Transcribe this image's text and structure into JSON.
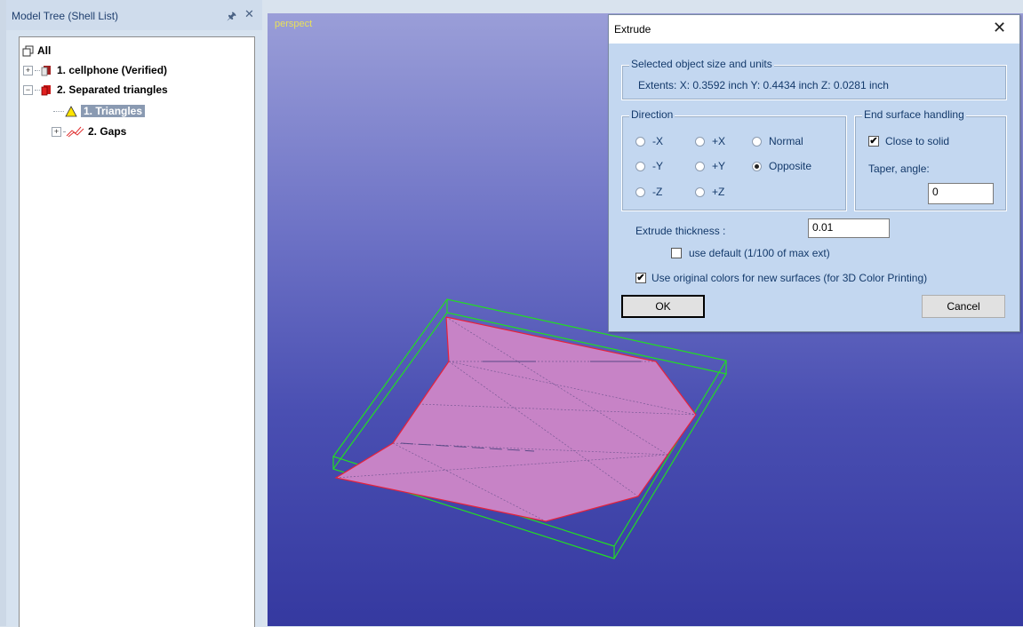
{
  "tree_panel": {
    "title": "Model Tree (Shell List)",
    "items": [
      {
        "label": "All",
        "icon": "shells-icon"
      },
      {
        "label": "1. cellphone (Verified)",
        "icon": "shell-icon"
      },
      {
        "label": "2. Separated triangles",
        "icon": "red-shell-icon"
      },
      {
        "label": "1. Triangles",
        "icon": "warning-triangle-icon",
        "selected": true
      },
      {
        "label": "2. Gaps",
        "icon": "gaps-icon"
      }
    ]
  },
  "viewport": {
    "view_label": "perspect"
  },
  "dialog": {
    "title": "Extrude",
    "size_group": {
      "caption": "Selected object size and units",
      "extents": "Extents:  X: 0.3592 inch  Y: 0.4434 inch  Z: 0.0281 inch"
    },
    "direction_group": {
      "caption": "Direction",
      "options": [
        "-X",
        "+X",
        "Normal",
        "-Y",
        "+Y",
        "Opposite",
        "-Z",
        "+Z"
      ],
      "selected": "Opposite"
    },
    "end_surface_group": {
      "caption": "End surface handling",
      "close_to_solid_label": "Close to solid",
      "close_to_solid_checked": true,
      "taper_label": "Taper, angle:",
      "taper_value": "0"
    },
    "thickness_label": "Extrude thickness :",
    "thickness_value": "0.01",
    "use_default_label": "use default (1/100 of max ext)",
    "use_default_checked": false,
    "original_colors_label": "Use original colors for new surfaces (for 3D Color Printing)",
    "original_colors_checked": true,
    "ok_label": "OK",
    "cancel_label": "Cancel"
  },
  "colors": {
    "viewport_top": "#9a9ed8",
    "viewport_bottom": "#3539a0",
    "bbox_green": "#22dd22",
    "mesh_fill": "#c783c6",
    "mesh_edge": "#e8203a"
  }
}
